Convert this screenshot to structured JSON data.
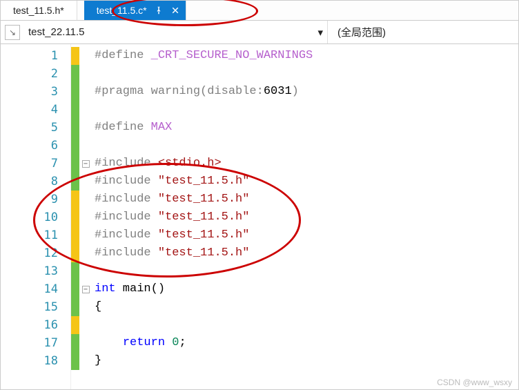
{
  "tabs": {
    "inactive": "test_11.5.h*",
    "active": "test_11.5.c*"
  },
  "toolbar": {
    "selector": "test_22.11.5",
    "scope": "(全局范围)"
  },
  "code": {
    "lines": [
      {
        "n": 1,
        "mark": "yellow",
        "html": "<span class='kw-pre'>#define </span><span class='kw-def'>_CRT_SECURE_NO_WARNINGS</span>"
      },
      {
        "n": 2,
        "mark": "green",
        "html": ""
      },
      {
        "n": 3,
        "mark": "green",
        "html": "<span class='kw-pre'>#pragma warning(disable:</span>6031<span class='kw-pre'>)</span>"
      },
      {
        "n": 4,
        "mark": "green",
        "html": ""
      },
      {
        "n": 5,
        "mark": "green",
        "html": "<span class='kw-pre'>#define </span><span class='kw-def'>MAX</span>"
      },
      {
        "n": 6,
        "mark": "green",
        "html": ""
      },
      {
        "n": 7,
        "mark": "green",
        "fold": "-",
        "html": "<span class='kw-pre'>#include </span><span class='kw-inc'>&lt;stdio.h&gt;</span>"
      },
      {
        "n": 8,
        "mark": "green",
        "html": "<span class='kw-pre'>#include </span><span class='kw-str'>\"test_11.5.h\"</span>"
      },
      {
        "n": 9,
        "mark": "yellow",
        "html": "<span class='kw-pre'>#include </span><span class='kw-str'>\"test_11.5.h\"</span>"
      },
      {
        "n": 10,
        "mark": "yellow",
        "html": "<span class='kw-pre'>#include </span><span class='kw-str'>\"test_11.5.h\"</span>"
      },
      {
        "n": 11,
        "mark": "yellow",
        "html": "<span class='kw-pre'>#include </span><span class='kw-str'>\"test_11.5.h\"</span>"
      },
      {
        "n": 12,
        "mark": "yellow",
        "html": "<span class='kw-pre'>#include </span><span class='kw-str'>\"test_11.5.h\"</span>"
      },
      {
        "n": 13,
        "mark": "green",
        "html": ""
      },
      {
        "n": 14,
        "mark": "green",
        "fold": "-",
        "html": "<span class='kw-blue'>int</span> main()"
      },
      {
        "n": 15,
        "mark": "green",
        "html": "{"
      },
      {
        "n": 16,
        "mark": "yellow",
        "html": ""
      },
      {
        "n": 17,
        "mark": "green",
        "html": "    <span class='kw-blue'>return</span> <span class='kw-num'>0</span>;"
      },
      {
        "n": 18,
        "mark": "green",
        "html": "}"
      }
    ]
  },
  "watermark": "CSDN @www_wsxy"
}
